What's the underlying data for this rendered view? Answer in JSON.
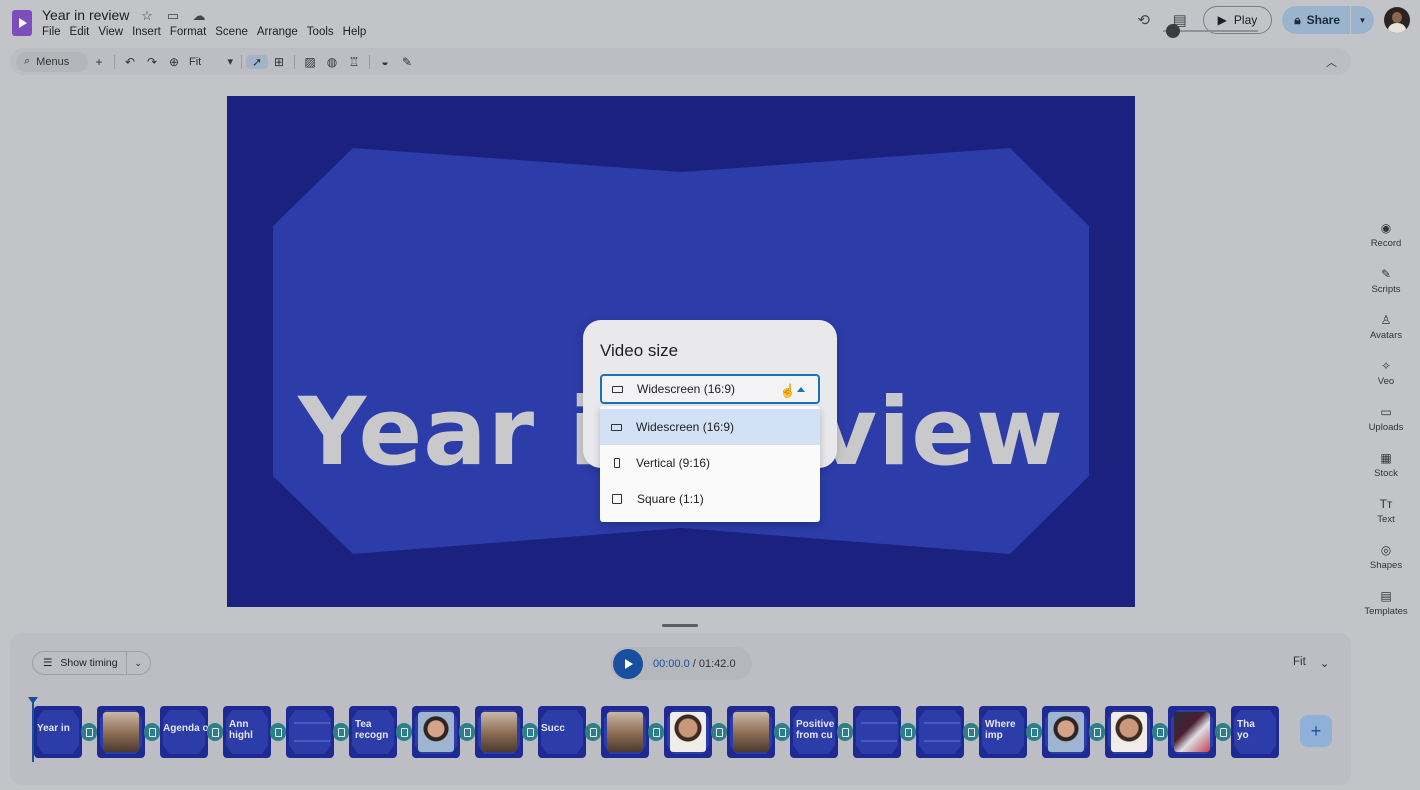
{
  "header": {
    "title": "Year in review",
    "menus": [
      "File",
      "Edit",
      "View",
      "Insert",
      "Format",
      "Scene",
      "Arrange",
      "Tools",
      "Help"
    ],
    "play_label": "Play",
    "share_label": "Share"
  },
  "toolbar": {
    "search_label": "Menus",
    "zoom_value": "Fit"
  },
  "slide": {
    "title_text": "Year in review"
  },
  "dialog": {
    "title": "Video size",
    "selected": "Widescreen (16:9)",
    "options": [
      {
        "label": "Widescreen (16:9)",
        "icon": "widescreen-ratio-icon",
        "selected": true
      },
      {
        "label": "Vertical (9:16)",
        "icon": "vertical-ratio-icon",
        "selected": false
      },
      {
        "label": "Square (1:1)",
        "icon": "square-ratio-icon",
        "selected": false
      }
    ]
  },
  "rail": {
    "items": [
      {
        "label": "Record",
        "icon": "record-icon",
        "glyph": "◉"
      },
      {
        "label": "Scripts",
        "icon": "scripts-icon",
        "glyph": "✎"
      },
      {
        "label": "Avatars",
        "icon": "avatars-icon",
        "glyph": "♙"
      },
      {
        "label": "Veo",
        "icon": "veo-icon",
        "glyph": "✧"
      },
      {
        "label": "Uploads",
        "icon": "uploads-icon",
        "glyph": "▭"
      },
      {
        "label": "Stock",
        "icon": "stock-icon",
        "glyph": "▦"
      },
      {
        "label": "Text",
        "icon": "text-icon",
        "glyph": "Tт"
      },
      {
        "label": "Shapes",
        "icon": "shapes-icon",
        "glyph": "◎"
      },
      {
        "label": "Templates",
        "icon": "templates-icon",
        "glyph": "▤"
      }
    ]
  },
  "timeline": {
    "show_timing_label": "Show timing",
    "current_time": "00:00.0",
    "total_time": "/ 01:42.0",
    "zoom_label": "Fit",
    "scenes": [
      {
        "text": "Year in",
        "kind": "title"
      },
      {
        "text": "",
        "kind": "photo"
      },
      {
        "text": "Agenda o",
        "kind": "title"
      },
      {
        "text": "Ann\nhighl",
        "kind": "title"
      },
      {
        "text": "",
        "kind": "list"
      },
      {
        "text": "Tea\nrecogn",
        "kind": "title"
      },
      {
        "text": "",
        "kind": "portrait"
      },
      {
        "text": "",
        "kind": "photo"
      },
      {
        "text": "Succ",
        "kind": "title"
      },
      {
        "text": "",
        "kind": "photo"
      },
      {
        "text": "",
        "kind": "face"
      },
      {
        "text": "",
        "kind": "photo"
      },
      {
        "text": "Positive\nfrom cu",
        "kind": "title"
      },
      {
        "text": "",
        "kind": "text"
      },
      {
        "text": "",
        "kind": "text"
      },
      {
        "text": "Where\nimp",
        "kind": "title"
      },
      {
        "text": "",
        "kind": "portrait"
      },
      {
        "text": "",
        "kind": "face"
      },
      {
        "text": "",
        "kind": "red"
      },
      {
        "text": "Tha\nyo",
        "kind": "title"
      }
    ]
  },
  "colors": {
    "slide_bg": "#1b217f",
    "slide_shape": "#2c3ca8",
    "accent": "#1a73b8",
    "play_blue": "#1a4fa0"
  }
}
